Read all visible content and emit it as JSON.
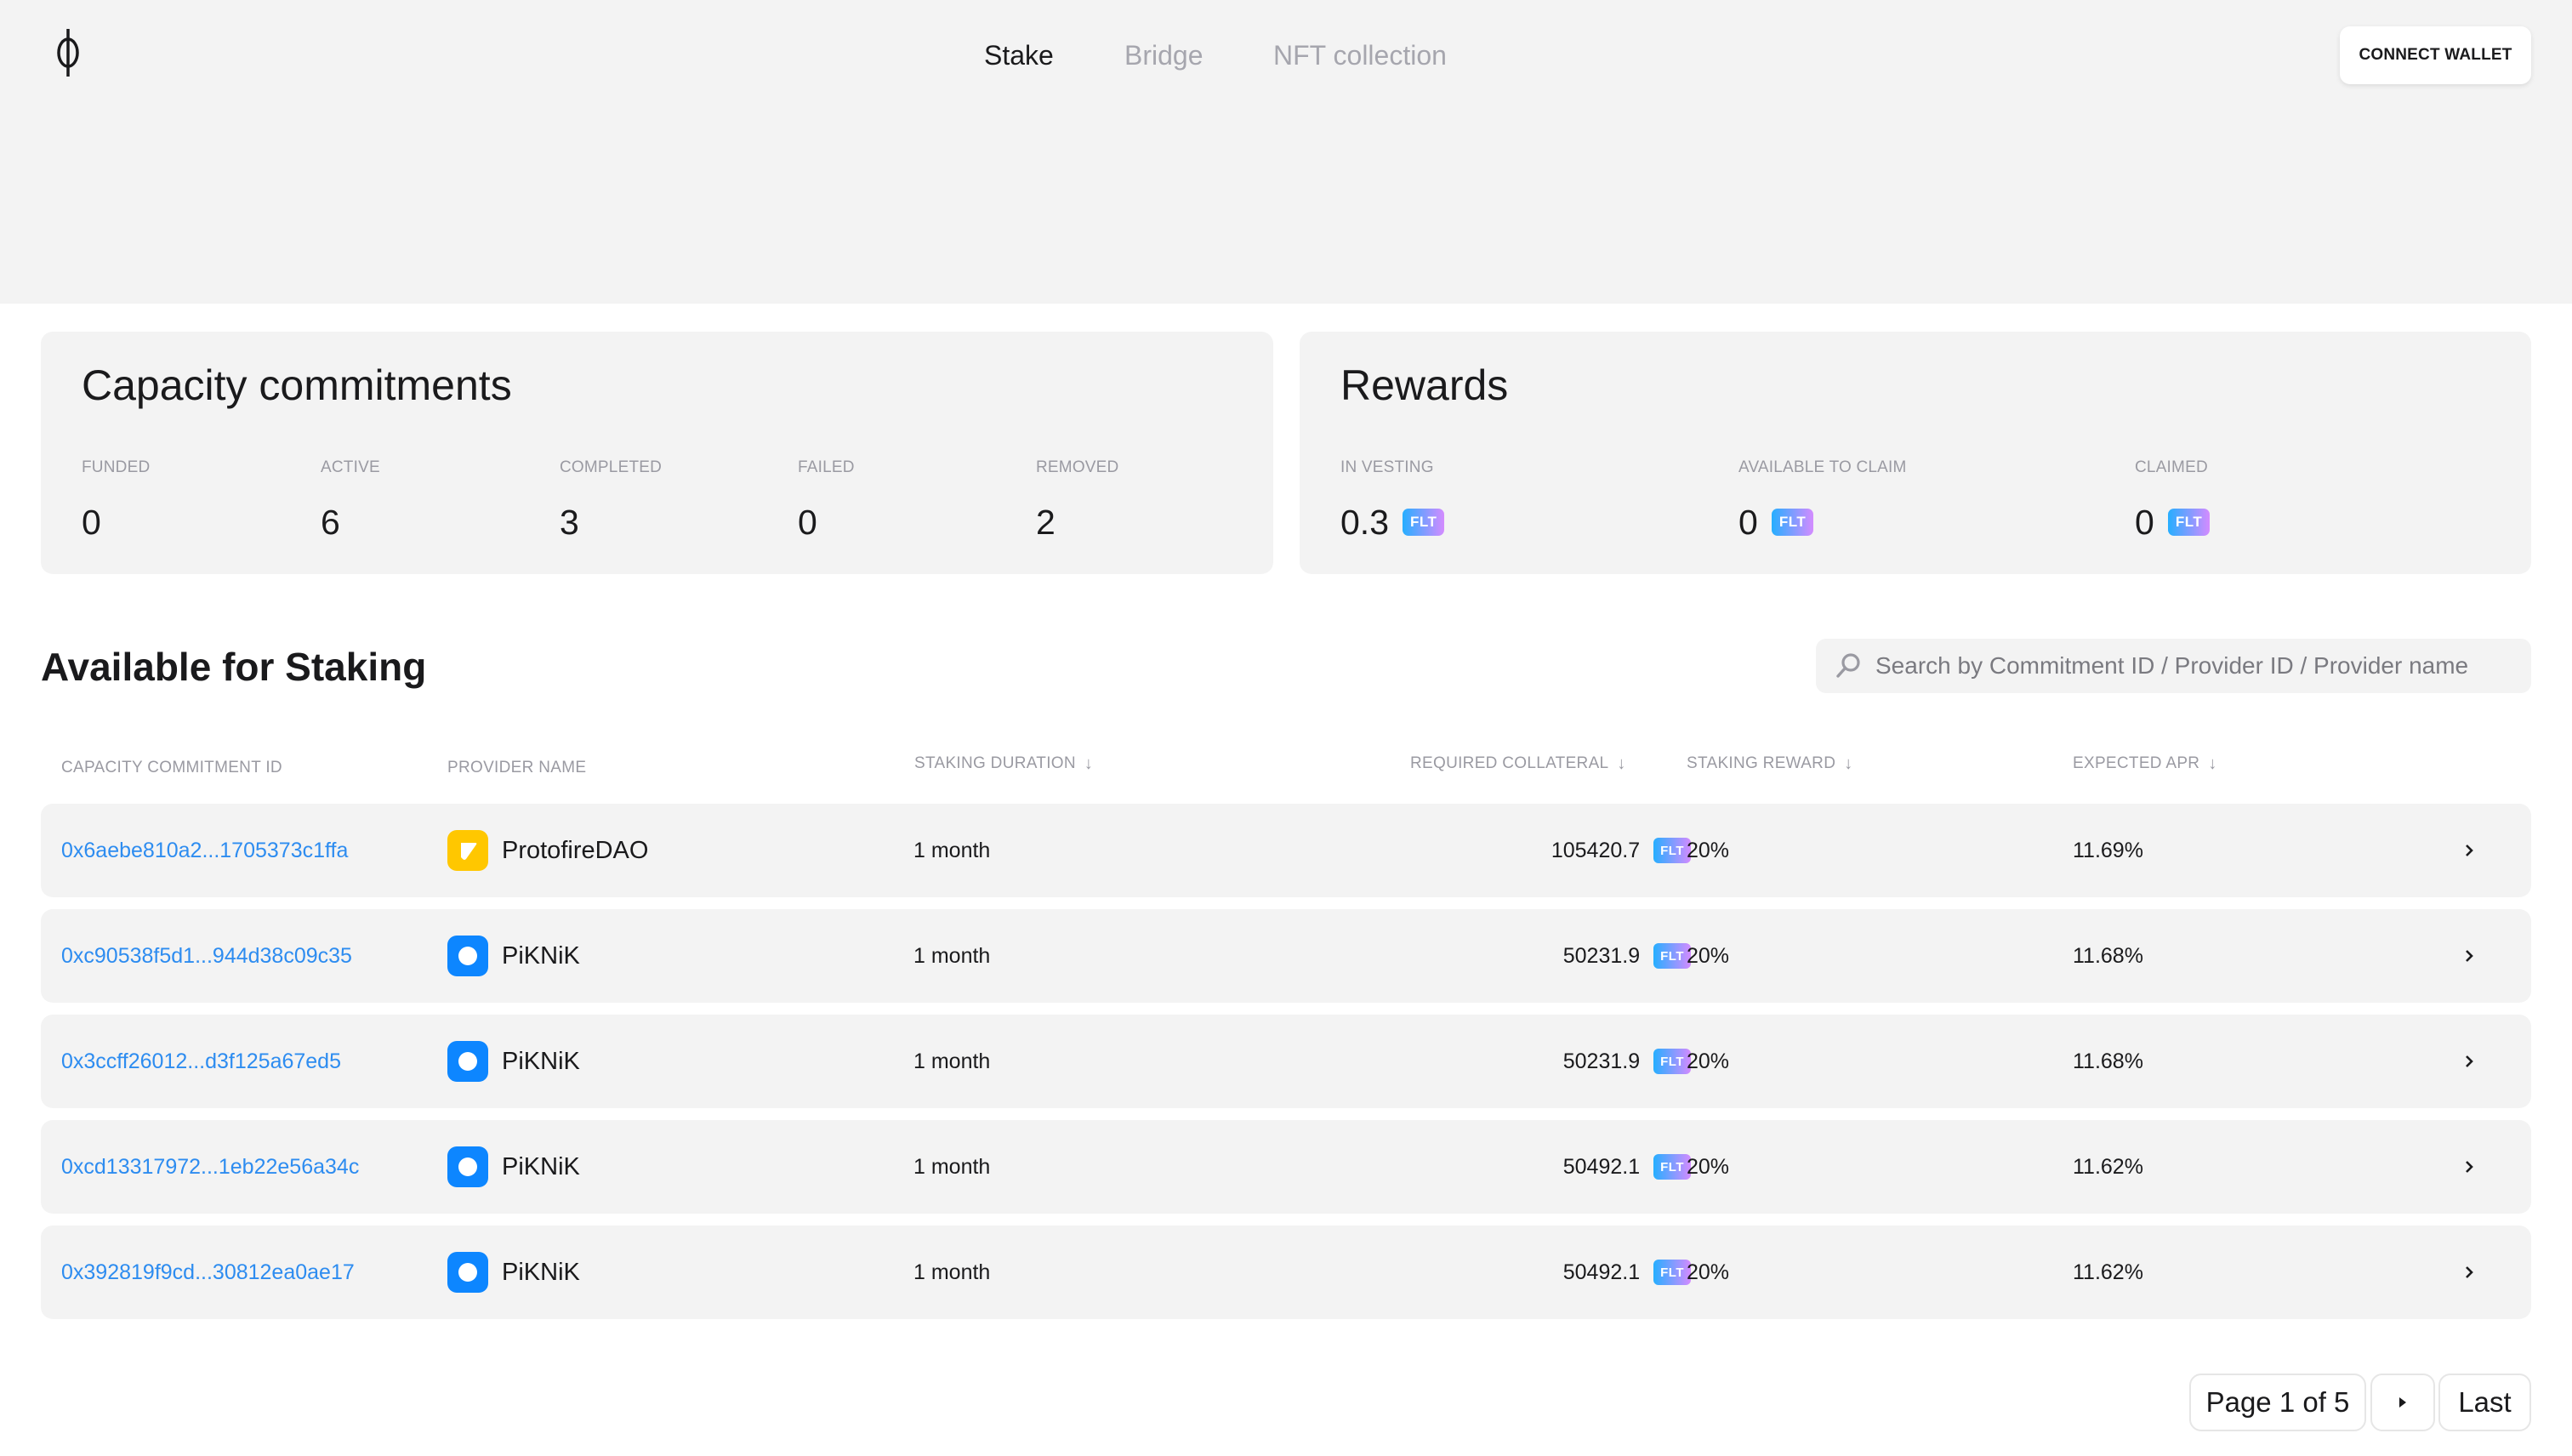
{
  "header": {
    "logo_icon": "phi-logo-icon",
    "nav": [
      {
        "label": "Stake",
        "active": true
      },
      {
        "label": "Bridge",
        "active": false
      },
      {
        "label": "NFT collection",
        "active": false
      }
    ],
    "connect_wallet_label": "CONNECT WALLET"
  },
  "capacity_card": {
    "title": "Capacity commitments",
    "stats": [
      {
        "label": "FUNDED",
        "value": "0"
      },
      {
        "label": "ACTIVE",
        "value": "6"
      },
      {
        "label": "COMPLETED",
        "value": "3"
      },
      {
        "label": "FAILED",
        "value": "0"
      },
      {
        "label": "REMOVED",
        "value": "2"
      }
    ]
  },
  "rewards_card": {
    "title": "Rewards",
    "token": "FLT",
    "stats": [
      {
        "label": "IN VESTING",
        "value": "0.3"
      },
      {
        "label": "AVAILABLE TO CLAIM",
        "value": "0"
      },
      {
        "label": "CLAIMED",
        "value": "0"
      }
    ]
  },
  "staking": {
    "title": "Available for Staking",
    "search_placeholder": "Search by Commitment ID / Provider ID / Provider name",
    "search_value": "",
    "columns": [
      {
        "label": "CAPACITY COMMITMENT ID",
        "sortable": false
      },
      {
        "label": "PROVIDER NAME",
        "sortable": false
      },
      {
        "label": "STAKING DURATION",
        "sortable": true
      },
      {
        "label": "REQUIRED COLLATERAL",
        "sortable": true
      },
      {
        "label": "STAKING REWARD",
        "sortable": true
      },
      {
        "label": "EXPECTED APR",
        "sortable": true
      }
    ],
    "sort_icon": "↓",
    "token": "FLT",
    "rows": [
      {
        "id": "0x6aebe810a2...1705373c1ffa",
        "provider": "ProtofireDAO",
        "provider_icon": "protofire-logo-icon",
        "provider_color": "#FFC700",
        "duration": "1 month",
        "collateral": "105420.7",
        "reward": "20%",
        "apr": "11.69%"
      },
      {
        "id": "0xc90538f5d1...944d38c09c35",
        "provider": "PiKNiK",
        "provider_icon": "piknik-logo-icon",
        "provider_color": "#0D86FF",
        "duration": "1 month",
        "collateral": "50231.9",
        "reward": "20%",
        "apr": "11.68%"
      },
      {
        "id": "0x3ccff26012...d3f125a67ed5",
        "provider": "PiKNiK",
        "provider_icon": "piknik-logo-icon",
        "provider_color": "#0D86FF",
        "duration": "1 month",
        "collateral": "50231.9",
        "reward": "20%",
        "apr": "11.68%"
      },
      {
        "id": "0xcd13317972...1eb22e56a34c",
        "provider": "PiKNiK",
        "provider_icon": "piknik-logo-icon",
        "provider_color": "#0D86FF",
        "duration": "1 month",
        "collateral": "50492.1",
        "reward": "20%",
        "apr": "11.62%"
      },
      {
        "id": "0x392819f9cd...30812ea0ae17",
        "provider": "PiKNiK",
        "provider_icon": "piknik-logo-icon",
        "provider_color": "#0D86FF",
        "duration": "1 month",
        "collateral": "50492.1",
        "reward": "20%",
        "apr": "11.62%"
      }
    ]
  },
  "pagination": {
    "page_label": "Page 1 of 5",
    "current_page": 1,
    "total_pages": 5,
    "next_icon": "triangle-right-icon",
    "last_label": "Last"
  },
  "colors": {
    "link": "#2D8CF0",
    "flt_gradient_start": "#26AEFF",
    "flt_gradient_end": "#D48BFF",
    "muted_text": "#9A9AA2",
    "surface": "#F3F3F3"
  }
}
